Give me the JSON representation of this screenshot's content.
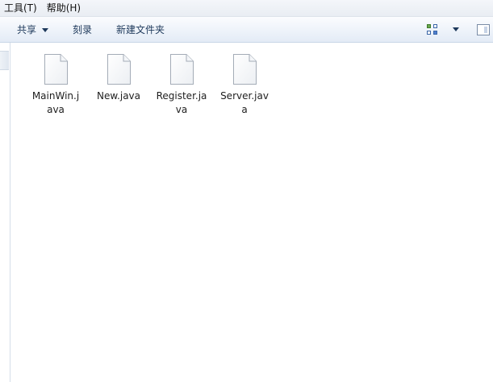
{
  "menubar": {
    "items": [
      {
        "label": "工具(T)"
      },
      {
        "label": "帮助(H)"
      }
    ]
  },
  "toolbar": {
    "share_label": "共享",
    "burn_label": "刻录",
    "new_folder_label": "新建文件夹"
  },
  "files": [
    {
      "name": "MainWin.java",
      "display": "MainWin.j\nava",
      "icon": "java-file-icon"
    },
    {
      "name": "New.java",
      "display": "New.java",
      "icon": "java-file-icon"
    },
    {
      "name": "Register.java",
      "display": "Register.ja\nva",
      "icon": "java-file-icon"
    },
    {
      "name": "Server.java",
      "display": "Server.jav\na",
      "icon": "java-file-icon"
    }
  ],
  "colors": {
    "toolbar_text": "#1e395b",
    "menubar_bg": "#eef1f6",
    "content_bg": "#ffffff"
  }
}
